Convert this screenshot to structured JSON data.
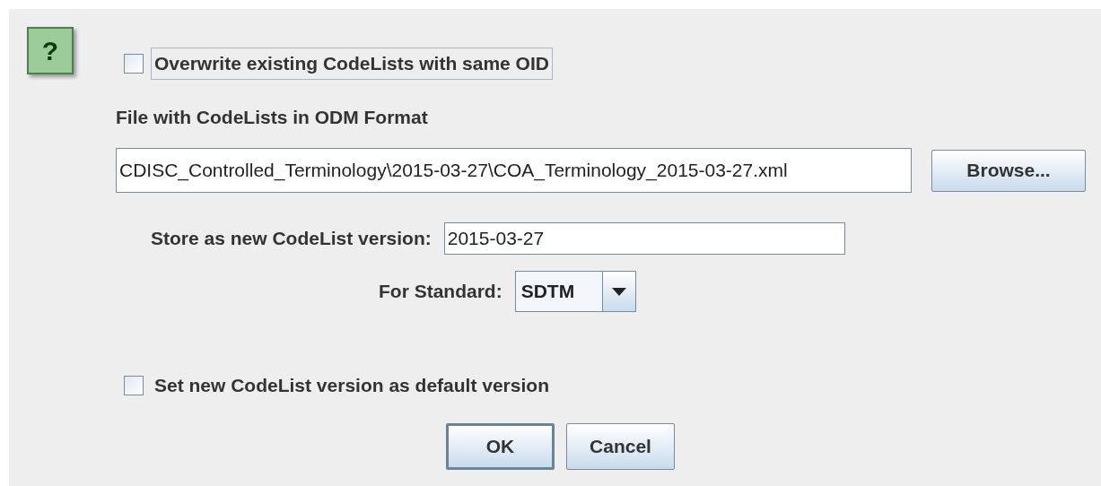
{
  "help_button": {
    "label": "?"
  },
  "overwrite": {
    "label": "Overwrite existing CodeLists with same OID",
    "checked": false,
    "focused": true
  },
  "file": {
    "label": "File with CodeLists in ODM Format",
    "value": "CDISC_Controlled_Terminology\\2015-03-27\\COA_Terminology_2015-03-27.xml",
    "browse": "Browse..."
  },
  "version": {
    "label": "Store as new CodeList version:",
    "value": "2015-03-27"
  },
  "standard": {
    "label": "For Standard:",
    "value": "SDTM"
  },
  "set_default": {
    "label": "Set new CodeList version as default version",
    "checked": false,
    "focused": false
  },
  "buttons": [
    {
      "label": "OK",
      "default": true
    },
    {
      "label": "Cancel",
      "default": false
    }
  ]
}
